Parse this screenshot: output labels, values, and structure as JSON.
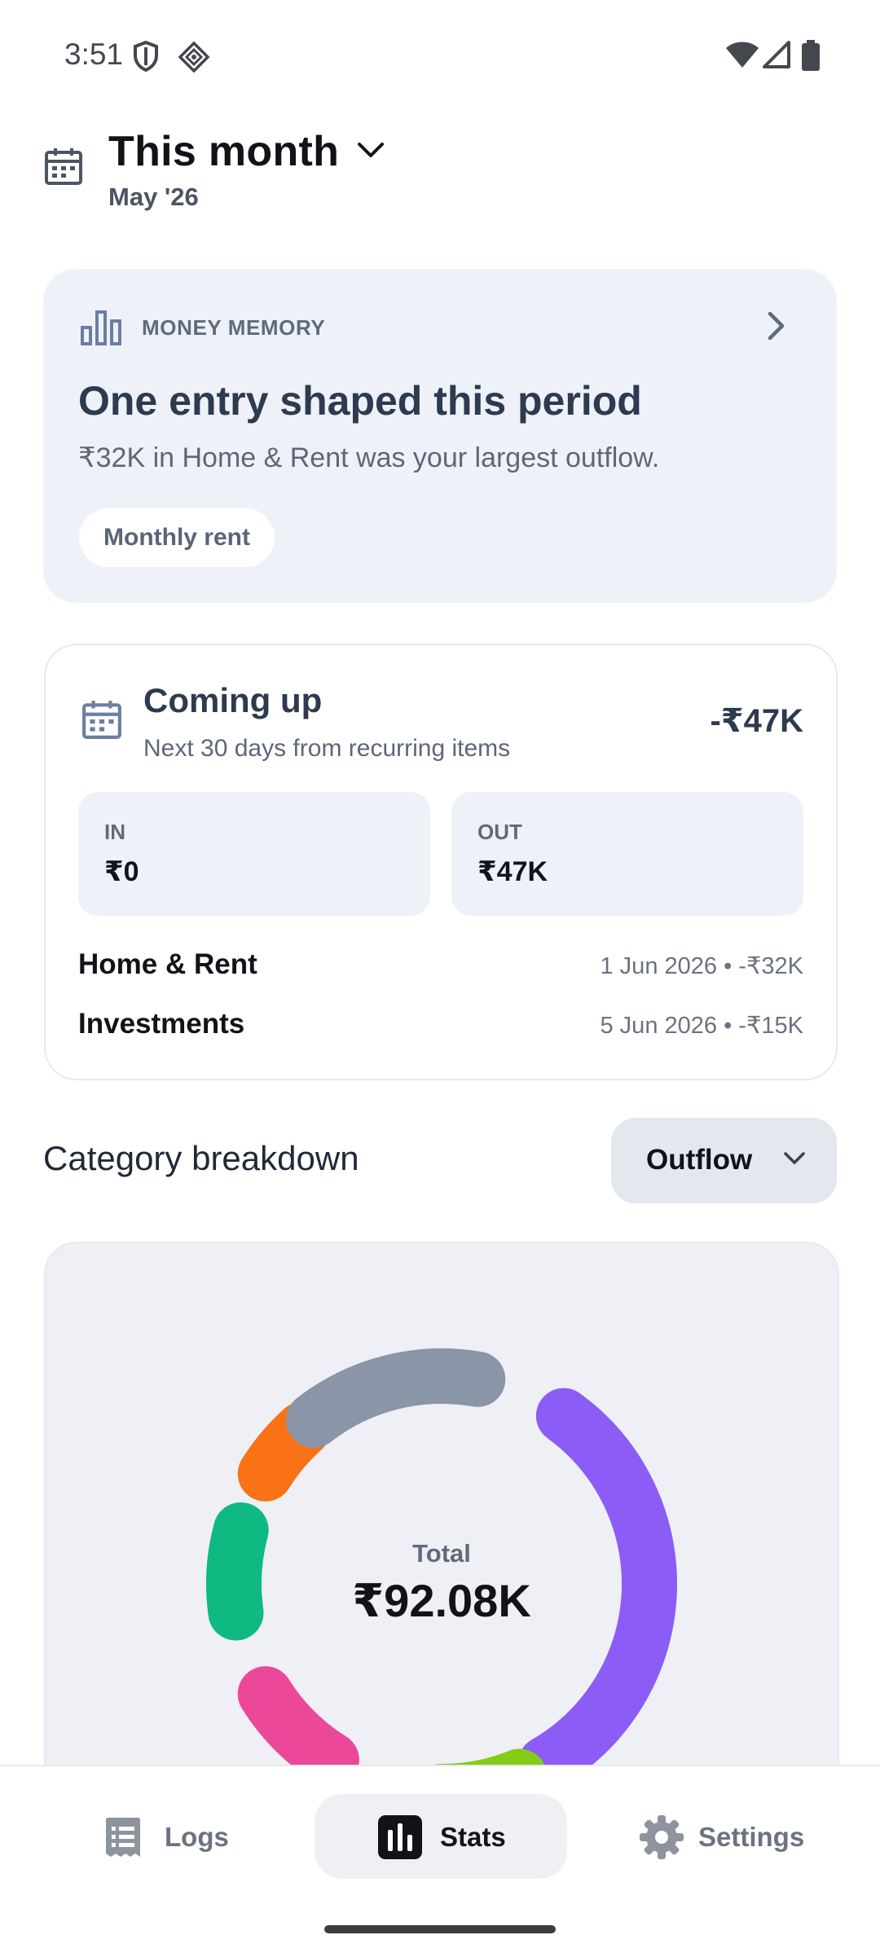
{
  "status_bar": {
    "time": "3:51"
  },
  "header": {
    "title": "This month",
    "subtitle": "May '26"
  },
  "money_memory": {
    "label": "MONEY MEMORY",
    "title": "One entry shaped this period",
    "description": "₹32K in Home & Rent was your largest outflow.",
    "chip": "Monthly rent"
  },
  "coming_up": {
    "title": "Coming up",
    "subtitle": "Next 30 days from recurring items",
    "total": "-₹47K",
    "in_label": "IN",
    "in_value": "₹0",
    "out_label": "OUT",
    "out_value": "₹47K",
    "items": [
      {
        "name": "Home & Rent",
        "meta": "1 Jun 2026 • -₹32K"
      },
      {
        "name": "Investments",
        "meta": "5 Jun 2026 • -₹15K"
      }
    ]
  },
  "category_breakdown": {
    "title": "Category breakdown",
    "filter": "Outflow",
    "total_label": "Total",
    "total_value": "₹92.08K"
  },
  "chart_data": {
    "type": "pie",
    "variant": "donut",
    "segment_colors": [
      "#8b5cf6",
      "#84cc16",
      "#ec4899",
      "#10b981",
      "#f97316",
      "#8b95a8"
    ]
  },
  "bottom_nav": {
    "items": [
      {
        "label": "Logs",
        "icon": "receipt-icon",
        "selected": false
      },
      {
        "label": "Stats",
        "icon": "bar-chart-icon",
        "selected": true
      },
      {
        "label": "Settings",
        "icon": "gear-icon",
        "selected": false
      }
    ]
  },
  "colors": {
    "card_background": "#eef2f8",
    "accent_text": "#2d3a4f",
    "selected_nav": "#eef0f3"
  }
}
